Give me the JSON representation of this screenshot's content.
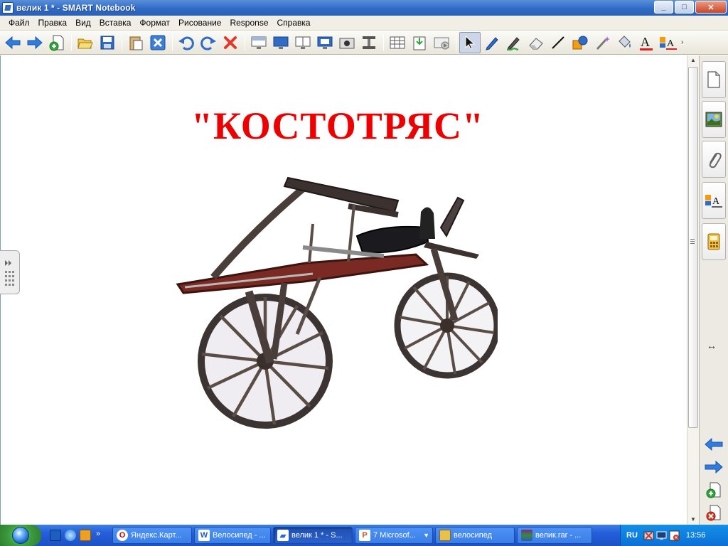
{
  "window": {
    "title": "велик 1 * - SMART Notebook",
    "buttons": {
      "minimize": "_",
      "maximize": "□",
      "close": "✕"
    }
  },
  "menu": [
    "Файл",
    "Правка",
    "Вид",
    "Вставка",
    "Формат",
    "Рисование",
    "Response",
    "Справка"
  ],
  "toolbar": {
    "tools": [
      "back-arrow",
      "forward-arrow",
      "add-page",
      "open-file",
      "save",
      "paste",
      "delete-page",
      "undo",
      "redo",
      "delete",
      "screen-shade",
      "full-screen",
      "dual-page",
      "transparent-background",
      "capture",
      "document-camera",
      "insert-table",
      "import",
      "insert-video",
      "select",
      "pen",
      "creative-pen",
      "eraser",
      "line",
      "shapes",
      "magic-pen",
      "fill",
      "text",
      "properties"
    ],
    "more": "›"
  },
  "slide": {
    "title": "\"КОСТОТРЯС\"",
    "title_color": "#ee0000",
    "image": "wooden-draisine-bicycle"
  },
  "sidebar": {
    "tabs": [
      "page-sorter",
      "gallery",
      "attachments",
      "properties",
      "add-ons"
    ],
    "resize": "↔"
  },
  "taskbar": {
    "quick_launch_more": "»",
    "tasks": [
      {
        "label": "Яндекс.Карт...",
        "icon": "opera",
        "color": "#d00000"
      },
      {
        "label": "Велосипед - ...",
        "icon": "word",
        "color": "#2a5bb8"
      },
      {
        "label": "велик 1 * - S...",
        "icon": "smart",
        "color": "#2f6bc7",
        "active": true
      },
      {
        "label": "7 Microsof...",
        "icon": "powerpoint",
        "color": "#c8522a",
        "dropdown": true
      },
      {
        "label": "велосипед",
        "icon": "folder",
        "color": "#e8c14a"
      },
      {
        "label": "велик.rar - ...",
        "icon": "winrar",
        "color": "#7a2a8a"
      }
    ],
    "lang": "RU",
    "time": "13:56"
  }
}
